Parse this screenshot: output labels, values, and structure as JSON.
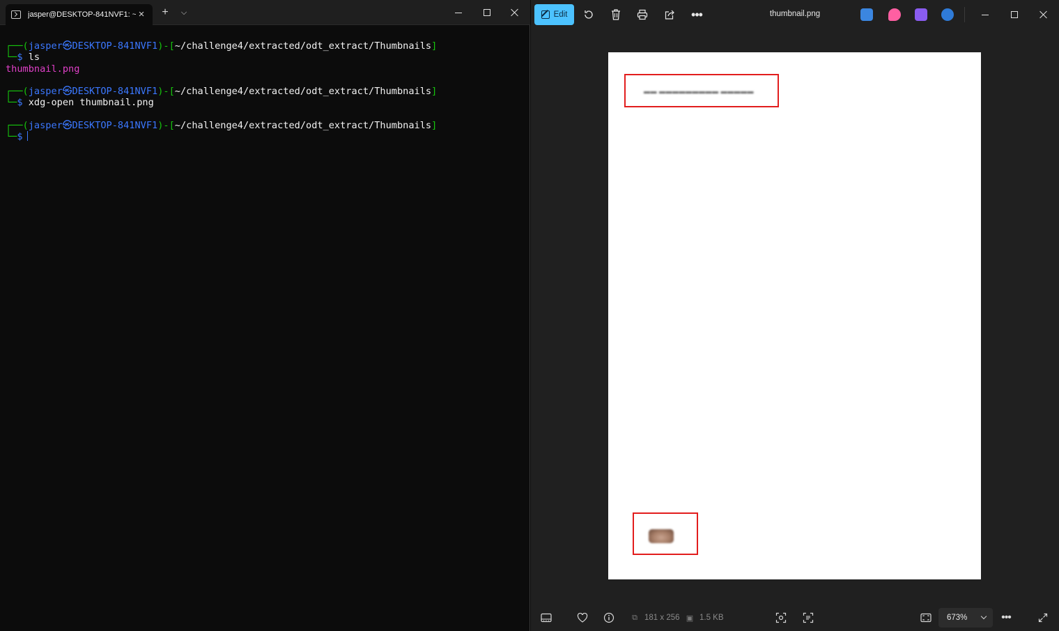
{
  "terminal": {
    "tab_title": "jasper@DESKTOP-841NVF1: ~,",
    "new_tab_symbol": "+",
    "prompt_user": "jasper",
    "prompt_at_symbol": "㉿",
    "prompt_host": "DESKTOP-841NVF1",
    "prompt_path": "~/challenge4/extracted/odt_extract/Thumbnails",
    "prompt_dollar": "$",
    "box_top": "┌──(",
    "box_mid": ")-[",
    "box_end": "]",
    "box_bottom": "└─",
    "commands": [
      {
        "command": "ls",
        "output": "thumbnail.png"
      },
      {
        "command": "xdg-open thumbnail.png",
        "output": ""
      },
      {
        "command": "",
        "output": ""
      }
    ]
  },
  "viewer": {
    "edit_label": "Edit",
    "file_name": "thumbnail.png",
    "dimensions": "181 x 256",
    "file_size": "1.5 KB",
    "zoom": "673%",
    "icons": {
      "edit": "edit-pen-icon",
      "rotate": "rotate-icon",
      "delete": "trash-icon",
      "print": "printer-icon",
      "share": "share-icon",
      "more": "more-dots-icon",
      "filmstrip": "filmstrip-icon",
      "favorite": "heart-icon",
      "info": "info-icon",
      "visual_search": "visual-search-icon",
      "text_scan": "text-scan-icon",
      "fit": "fit-window-icon",
      "fullscreen": "fullscreen-icon"
    },
    "app_icon_colors": [
      "#3b86e0",
      "#ff5fa2",
      "#8a5cf0",
      "#2f7bd8"
    ]
  }
}
